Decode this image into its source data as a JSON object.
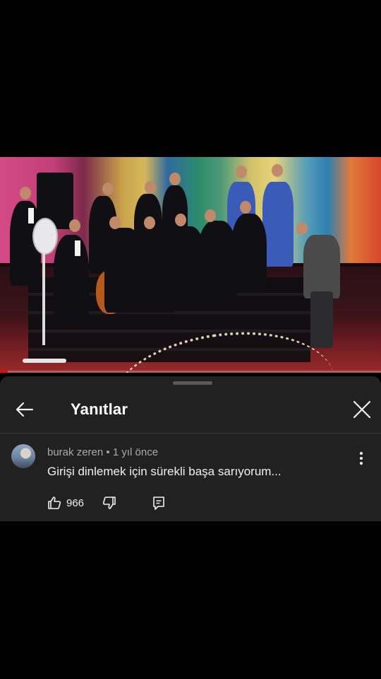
{
  "video": {
    "progress_fraction": 0.02
  },
  "panel": {
    "title": "Yanıtlar",
    "back_icon": "arrow-left-icon",
    "close_icon": "close-icon"
  },
  "comment": {
    "author": "burak zeren",
    "separator": "•",
    "time": "1 yıl önce",
    "text": "Girişi dinlemek için sürekli başa sarıyorum...",
    "likes": "966",
    "icons": {
      "like": "thumbs-up-icon",
      "dislike": "thumbs-down-icon",
      "reply": "reply-icon",
      "more": "more-vertical-icon"
    }
  },
  "colors": {
    "panel_bg": "#212121",
    "progress": "#ff0000",
    "meta_text": "#aaaaaa"
  }
}
